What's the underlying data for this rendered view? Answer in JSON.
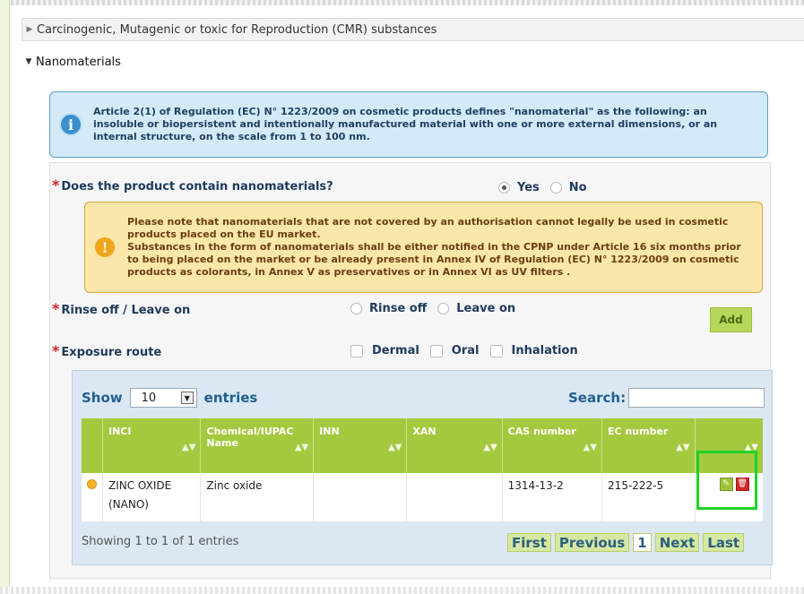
{
  "sections": {
    "cmr": {
      "label": "Carcinogenic, Mutagenic or toxic for Reproduction (CMR) substances"
    },
    "nano": {
      "label": "Nanomaterials"
    }
  },
  "info": {
    "icon": "info-icon",
    "text": "Article 2(1) of Regulation (EC) N° 1223/2009 on cosmetic products defines \"nanomaterial\" as the following: an insoluble or biopersistent and intentionally manufactured material with one or more external dimensions, or an internal structure, on the scale from 1 to 100 nm."
  },
  "question_nano": {
    "label": "Does the product contain nanomaterials?",
    "options": [
      "Yes",
      "No"
    ],
    "selected": "Yes"
  },
  "warning": {
    "icon": "warning-icon",
    "line1": "Please note that nanomaterials that are not covered by an authorisation cannot legally be used in cosmetic products placed on the EU market.",
    "line2": "Substances in the form of nanomaterials shall be either notified in the CPNP under Article 16 six months prior to being placed on the market or be already present in Annex IV of Regulation (EC) N° 1223/2009 on cosmetic products as colorants, in Annex V as preservatives or in Annex VI as UV filters ."
  },
  "rinse": {
    "label": "Rinse off / Leave on",
    "options": [
      "Rinse off",
      "Leave on"
    ]
  },
  "add_button": "Add",
  "exposure": {
    "label": "Exposure route",
    "options": [
      "Dermal",
      "Oral",
      "Inhalation"
    ]
  },
  "table": {
    "show_label": "Show",
    "entries_label": "entries",
    "page_size": "10",
    "search_label": "Search:",
    "search_value": "",
    "columns": [
      "INCI",
      "Chemical/IUPAC Name",
      "INN",
      "XAN",
      "CAS number",
      "EC number",
      ""
    ],
    "rows": [
      {
        "inci": "ZINC OXIDE (NANO)",
        "chemical": "Zinc oxide",
        "inn": "",
        "xan": "",
        "cas": "1314-13-2",
        "ec": "215-222-5"
      }
    ],
    "showing": "Showing 1 to 1 of 1 entries",
    "pager": {
      "first": "First",
      "previous": "Previous",
      "page": "1",
      "next": "Next",
      "last": "Last"
    }
  },
  "colors": {
    "accent": "#a5c93e",
    "info_bg": "#d4ebf7",
    "warning_bg": "#fbe8a8",
    "required": "#d0202a",
    "highlight": "#20d12a"
  }
}
